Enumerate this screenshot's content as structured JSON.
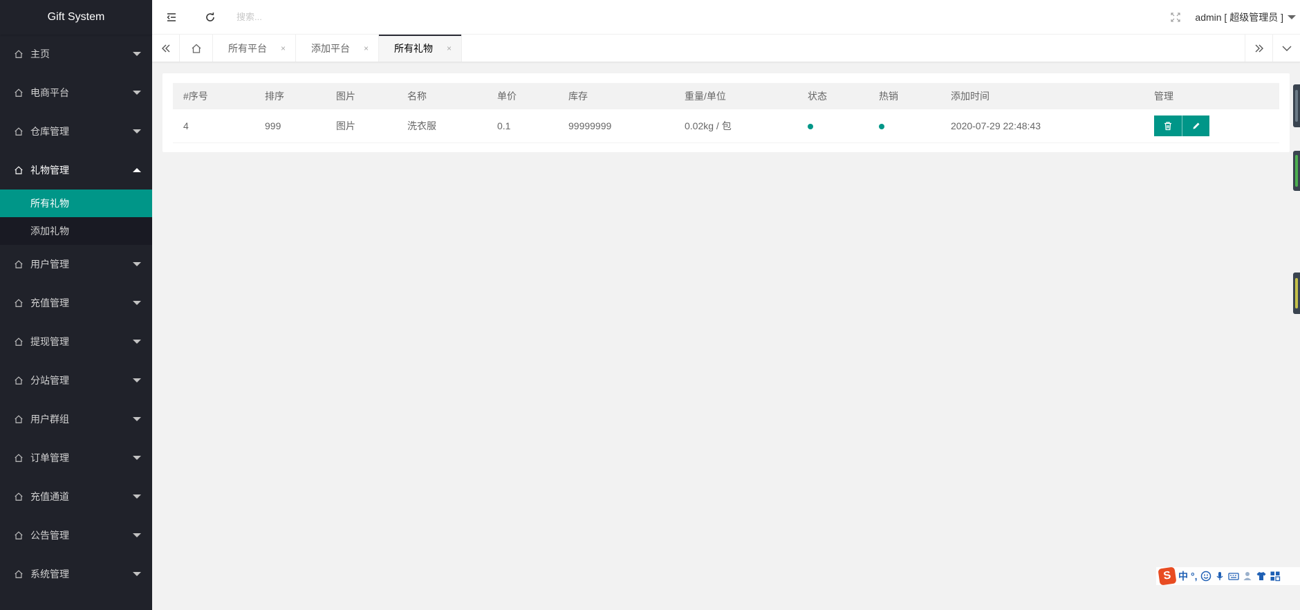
{
  "app": {
    "title": "Gift System"
  },
  "sidebar": {
    "items_top": [
      {
        "label": "主页"
      },
      {
        "label": "电商平台"
      },
      {
        "label": "仓库管理"
      }
    ],
    "open_item": {
      "label": "礼物管理",
      "children": [
        {
          "label": "所有礼物",
          "active": true
        },
        {
          "label": "添加礼物",
          "active": false
        }
      ]
    },
    "items_bottom": [
      {
        "label": "用户管理"
      },
      {
        "label": "充值管理"
      },
      {
        "label": "提现管理"
      },
      {
        "label": "分站管理"
      },
      {
        "label": "用户群组"
      },
      {
        "label": "订单管理"
      },
      {
        "label": "充值通道"
      },
      {
        "label": "公告管理"
      },
      {
        "label": "系统管理"
      }
    ]
  },
  "header": {
    "search_placeholder": "搜索...",
    "user_label": "admin [ 超级管理员 ]"
  },
  "tabs": [
    {
      "label": "所有平台",
      "close": "×",
      "active": false
    },
    {
      "label": "添加平台",
      "close": "×",
      "active": false
    },
    {
      "label": "所有礼物",
      "close": "×",
      "active": true
    }
  ],
  "table": {
    "columns": [
      "#序号",
      "排序",
      "图片",
      "名称",
      "单价",
      "库存",
      "重量/单位",
      "状态",
      "热销",
      "添加时间",
      "管理"
    ],
    "rows": [
      {
        "id": "4",
        "sort": "999",
        "image": "图片",
        "name": "洗衣服",
        "price": "0.1",
        "stock": "99999999",
        "weight": "0.02kg / 包",
        "created_at": "2020-07-29 22:48:43"
      }
    ]
  },
  "ime": {
    "lang": "中",
    "punct": "°,"
  },
  "colors": {
    "sidebar_bg": "#20222a",
    "accent": "#009688",
    "tab_active_line": "#292b34"
  }
}
